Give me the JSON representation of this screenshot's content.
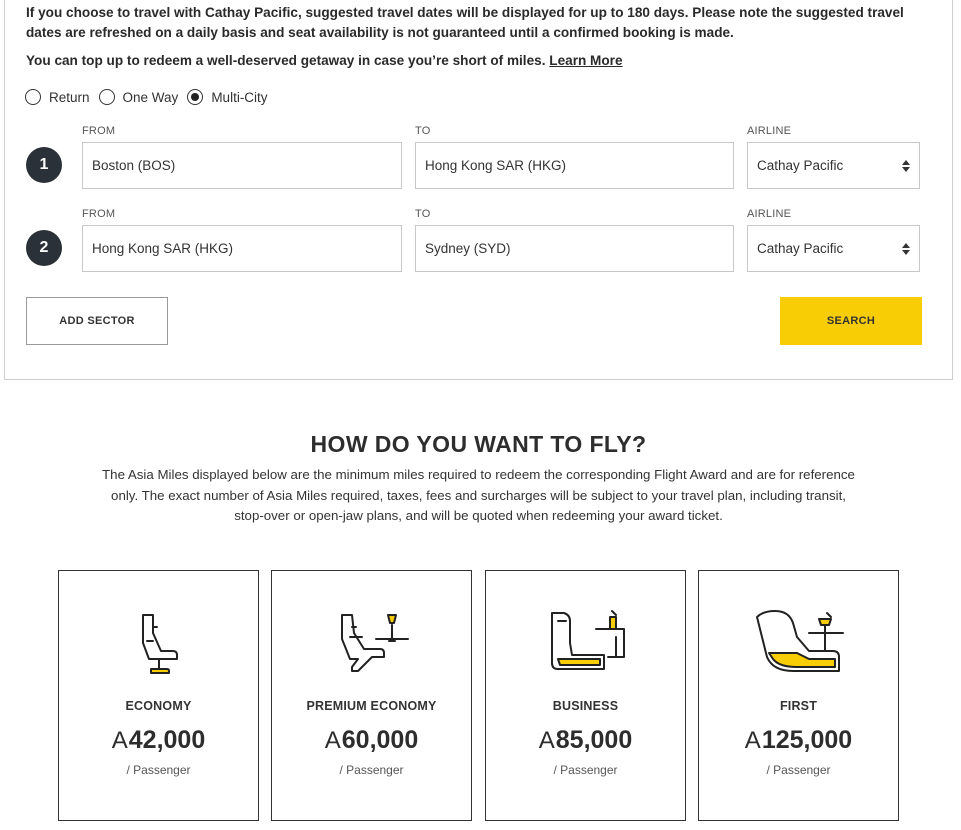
{
  "notice": {
    "text": "If you choose to travel with Cathay Pacific, suggested travel dates will be displayed for up to 180 days. Please note the suggested travel dates are refreshed on a daily basis and seat availability is not guaranteed until a confirmed booking is made.",
    "topup_text": "You can top up to redeem a well-deserved getaway in case you’re short of miles.",
    "learn_more": "Learn More"
  },
  "trip_type": {
    "options": [
      {
        "label": "Return",
        "selected": false
      },
      {
        "label": "One Way",
        "selected": false
      },
      {
        "label": "Multi-City",
        "selected": true
      }
    ]
  },
  "sectors": [
    {
      "number": "1",
      "from_label": "FROM",
      "from_value": "Boston (BOS)",
      "to_label": "TO",
      "to_value": "Hong Kong SAR (HKG)",
      "airline_label": "AIRLINE",
      "airline_value": "Cathay Pacific"
    },
    {
      "number": "2",
      "from_label": "FROM",
      "from_value": "Hong Kong SAR (HKG)",
      "to_label": "TO",
      "to_value": "Sydney (SYD)",
      "airline_label": "AIRLINE",
      "airline_value": "Cathay Pacific"
    }
  ],
  "buttons": {
    "add_sector": "ADD SECTOR",
    "search": "SEARCH"
  },
  "colors": {
    "accent": "#f9cd05",
    "badge": "#2b3138"
  },
  "fly_section": {
    "title": "HOW DO YOU WANT TO FLY?",
    "description": "The Asia Miles displayed below are the minimum miles required to redeem the corresponding Flight Award and are for reference only. The exact number of Asia Miles required, taxes, fees and surcharges will be subject to your travel plan, including transit, stop-over or open-jaw plans, and will be quoted when redeeming your award ticket.",
    "mile_symbol": "A",
    "cabins": [
      {
        "name": "ECONOMY",
        "miles": "42,000",
        "per": "/ Passenger",
        "icon": "economy-seat-icon"
      },
      {
        "name": "PREMIUM ECONOMY",
        "miles": "60,000",
        "per": "/ Passenger",
        "icon": "premium-economy-seat-icon"
      },
      {
        "name": "BUSINESS",
        "miles": "85,000",
        "per": "/ Passenger",
        "icon": "business-seat-icon"
      },
      {
        "name": "FIRST",
        "miles": "125,000",
        "per": "/ Passenger",
        "icon": "first-seat-icon"
      }
    ]
  }
}
